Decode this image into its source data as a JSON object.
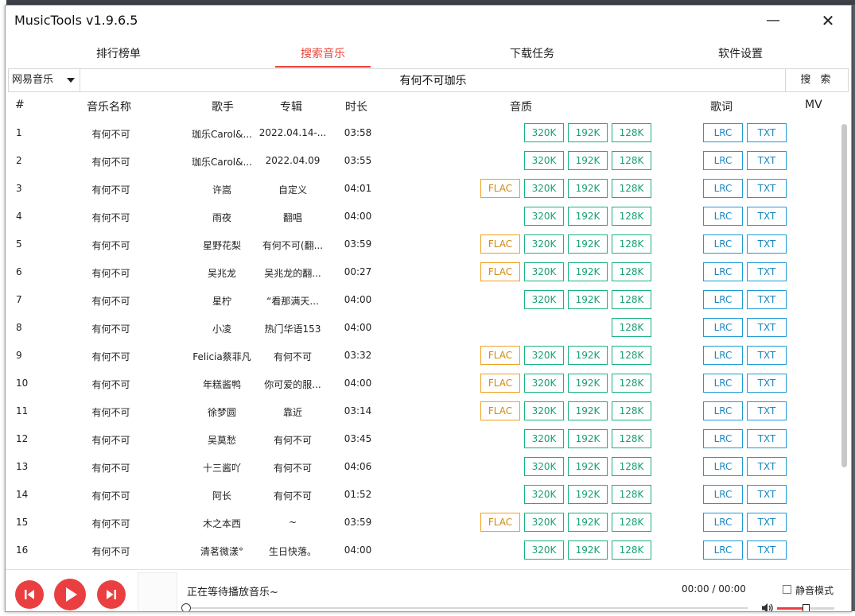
{
  "app": {
    "title": "MusicTools v1.9.6.5"
  },
  "window_controls": {
    "minimize": "—",
    "close": "✕"
  },
  "tabs": [
    {
      "label": "排行榜单",
      "active": false
    },
    {
      "label": "搜索音乐",
      "active": true
    },
    {
      "label": "下载任务",
      "active": false
    },
    {
      "label": "软件设置",
      "active": false
    }
  ],
  "search": {
    "source": "网易音乐",
    "query": "有何不可珈乐",
    "button": "搜 索"
  },
  "columns": {
    "index": "#",
    "name": "音乐名称",
    "artist": "歌手",
    "album": "专辑",
    "duration": "时长",
    "quality": "音质",
    "lyrics": "歌词",
    "mv": "MV"
  },
  "rows": [
    {
      "index": "1",
      "name": "有何不可",
      "artist": "珈乐Carol&...",
      "album": "2022.04.14-...",
      "duration": "03:58",
      "qualities": [
        "320K",
        "192K",
        "128K"
      ],
      "lyrics": [
        "LRC",
        "TXT"
      ]
    },
    {
      "index": "2",
      "name": "有何不可",
      "artist": "珈乐Carol&...",
      "album": "2022.04.09",
      "duration": "03:55",
      "qualities": [
        "320K",
        "192K",
        "128K"
      ],
      "lyrics": [
        "LRC",
        "TXT"
      ]
    },
    {
      "index": "3",
      "name": "有何不可",
      "artist": "许嵩",
      "album": "自定义",
      "duration": "04:01",
      "qualities": [
        "FLAC",
        "320K",
        "192K",
        "128K"
      ],
      "lyrics": [
        "LRC",
        "TXT"
      ]
    },
    {
      "index": "4",
      "name": "有何不可",
      "artist": "雨夜",
      "album": "翻唱",
      "duration": "04:00",
      "qualities": [
        "320K",
        "192K",
        "128K"
      ],
      "lyrics": [
        "LRC",
        "TXT"
      ]
    },
    {
      "index": "5",
      "name": "有何不可",
      "artist": "星野花梨",
      "album": "有何不可(翻...",
      "duration": "03:59",
      "qualities": [
        "FLAC",
        "320K",
        "192K",
        "128K"
      ],
      "lyrics": [
        "LRC",
        "TXT"
      ]
    },
    {
      "index": "6",
      "name": "有何不可",
      "artist": "吴兆龙",
      "album": "吴兆龙的翻...",
      "duration": "00:27",
      "qualities": [
        "FLAC",
        "320K",
        "192K",
        "128K"
      ],
      "lyrics": [
        "LRC",
        "TXT"
      ]
    },
    {
      "index": "7",
      "name": "有何不可",
      "artist": "星柠",
      "album": "“看那满天...",
      "duration": "04:00",
      "qualities": [
        "320K",
        "192K",
        "128K"
      ],
      "lyrics": [
        "LRC",
        "TXT"
      ]
    },
    {
      "index": "8",
      "name": "有何不可",
      "artist": "小凌",
      "album": "热门华语153",
      "duration": "04:00",
      "qualities": [
        "128K"
      ],
      "lyrics": [
        "LRC",
        "TXT"
      ]
    },
    {
      "index": "9",
      "name": "有何不可",
      "artist": "Felicia蔡菲凡",
      "album": "有何不可",
      "duration": "03:32",
      "qualities": [
        "FLAC",
        "320K",
        "192K",
        "128K"
      ],
      "lyrics": [
        "LRC",
        "TXT"
      ]
    },
    {
      "index": "10",
      "name": "有何不可",
      "artist": "年糕酱鸭",
      "album": "你可爱的服...",
      "duration": "04:00",
      "qualities": [
        "FLAC",
        "320K",
        "192K",
        "128K"
      ],
      "lyrics": [
        "LRC",
        "TXT"
      ]
    },
    {
      "index": "11",
      "name": "有何不可",
      "artist": "徐梦圆",
      "album": "靠近",
      "duration": "03:14",
      "qualities": [
        "FLAC",
        "320K",
        "192K",
        "128K"
      ],
      "lyrics": [
        "LRC",
        "TXT"
      ]
    },
    {
      "index": "12",
      "name": "有何不可",
      "artist": "吴莫愁",
      "album": "有何不可",
      "duration": "03:45",
      "qualities": [
        "320K",
        "192K",
        "128K"
      ],
      "lyrics": [
        "LRC",
        "TXT"
      ]
    },
    {
      "index": "13",
      "name": "有何不可",
      "artist": "十三酱吖",
      "album": "有何不可",
      "duration": "04:06",
      "qualities": [
        "320K",
        "192K",
        "128K"
      ],
      "lyrics": [
        "LRC",
        "TXT"
      ]
    },
    {
      "index": "14",
      "name": "有何不可",
      "artist": "阿长",
      "album": "有何不可",
      "duration": "01:52",
      "qualities": [
        "320K",
        "192K",
        "128K"
      ],
      "lyrics": [
        "LRC",
        "TXT"
      ]
    },
    {
      "index": "15",
      "name": "有何不可",
      "artist": "木之本西",
      "album": "~",
      "duration": "03:59",
      "qualities": [
        "FLAC",
        "320K",
        "192K",
        "128K"
      ],
      "lyrics": [
        "LRC",
        "TXT"
      ]
    },
    {
      "index": "16",
      "name": "有何不可",
      "artist": "清茗微漾°",
      "album": "生日快落。",
      "duration": "04:00",
      "qualities": [
        "320K",
        "192K",
        "128K"
      ],
      "lyrics": [
        "LRC",
        "TXT"
      ]
    }
  ],
  "player": {
    "status": "正在等待播放音乐~",
    "time": "00:00 / 00:00",
    "mute_label": "静音模式",
    "muted": false,
    "progress": 0,
    "volume": 0.5
  },
  "colors": {
    "accent": "#e8463a",
    "quality_green": "#18b27d",
    "flac_orange": "#f0a020",
    "lyric_blue": "#1e9ad6",
    "control_red": "#ea3f40"
  },
  "icons": {
    "prev": "skip-previous-icon",
    "play": "play-icon",
    "next": "skip-next-icon",
    "volume": "speaker-icon",
    "dropdown": "chevron-down-icon"
  }
}
